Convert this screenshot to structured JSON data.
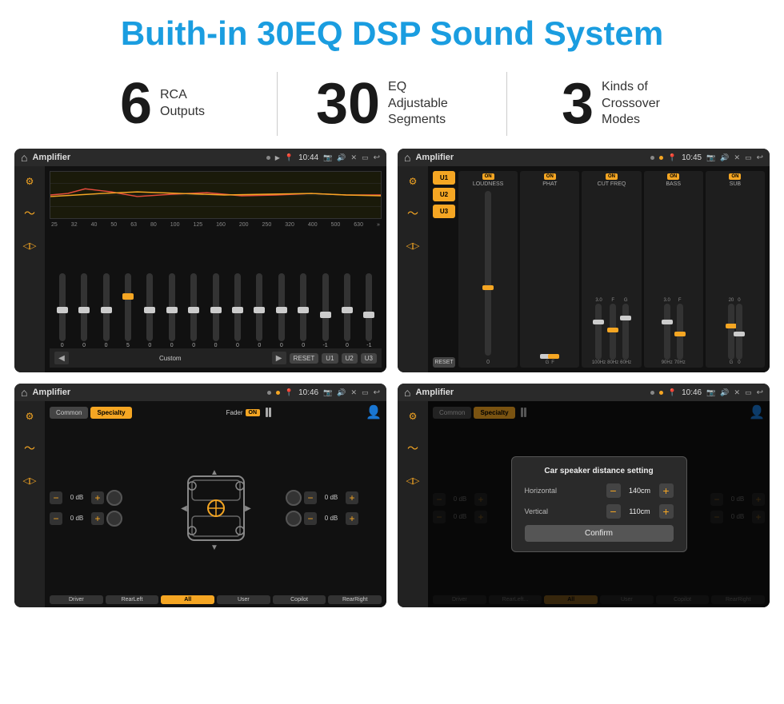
{
  "page": {
    "title": "Buith-in 30EQ DSP Sound System"
  },
  "stats": [
    {
      "number": "6",
      "text": "RCA\nOutputs"
    },
    {
      "number": "30",
      "text": "EQ Adjustable\nSegments"
    },
    {
      "number": "3",
      "text": "Kinds of\nCrossover Modes"
    }
  ],
  "screens": {
    "screen1": {
      "title": "Amplifier",
      "time": "10:44",
      "eq_bands": [
        "25",
        "32",
        "40",
        "50",
        "63",
        "80",
        "100",
        "125",
        "160",
        "200",
        "250",
        "320",
        "400",
        "500",
        "630"
      ],
      "eq_values": [
        "0",
        "0",
        "0",
        "5",
        "0",
        "0",
        "0",
        "0",
        "0",
        "0",
        "0",
        "0",
        "-1",
        "0",
        "-1"
      ],
      "eq_mode": "Custom",
      "btns": [
        "RESET",
        "U1",
        "U2",
        "U3"
      ]
    },
    "screen2": {
      "title": "Amplifier",
      "time": "10:45",
      "presets": [
        "U1",
        "U2",
        "U3"
      ],
      "channels": [
        "LOUDNESS",
        "PHAT",
        "CUT FREQ",
        "BASS",
        "SUB"
      ]
    },
    "screen3": {
      "title": "Amplifier",
      "time": "10:46",
      "tabs": [
        "Common",
        "Specialty"
      ],
      "active_tab": "Specialty",
      "fader_label": "Fader",
      "fader_on": "ON",
      "db_values": [
        "0 dB",
        "0 dB",
        "0 dB",
        "0 dB"
      ],
      "bottom_btns": [
        "Driver",
        "RearLeft",
        "All",
        "User",
        "Copilot",
        "RearRight"
      ]
    },
    "screen4": {
      "title": "Amplifier",
      "time": "10:46",
      "tabs": [
        "Common",
        "Specialty"
      ],
      "dialog": {
        "title": "Car speaker distance setting",
        "horizontal_label": "Horizontal",
        "horizontal_value": "140cm",
        "vertical_label": "Vertical",
        "vertical_value": "110cm",
        "confirm_btn": "Confirm"
      },
      "db_values_right": [
        "0 dB",
        "0 dB"
      ],
      "bottom_btns": [
        "Driver",
        "RearLeft",
        "All",
        "User",
        "Copilot",
        "RearRight"
      ]
    }
  }
}
